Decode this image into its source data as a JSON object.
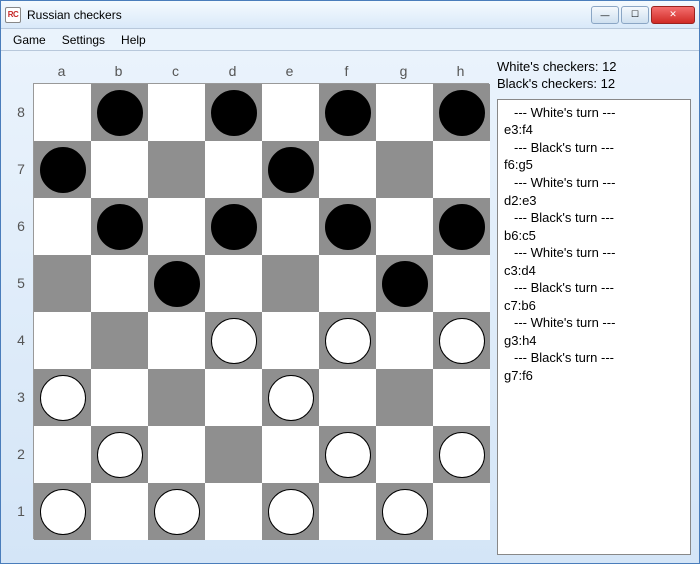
{
  "window": {
    "title": "Russian checkers",
    "icon_text": "RC"
  },
  "menubar": {
    "items": [
      "Game",
      "Settings",
      "Help"
    ]
  },
  "board": {
    "files": [
      "a",
      "b",
      "c",
      "d",
      "e",
      "f",
      "g",
      "h"
    ],
    "ranks": [
      "8",
      "7",
      "6",
      "5",
      "4",
      "3",
      "2",
      "1"
    ],
    "pieces": [
      {
        "file": "b",
        "rank": 8,
        "color": "black"
      },
      {
        "file": "d",
        "rank": 8,
        "color": "black"
      },
      {
        "file": "f",
        "rank": 8,
        "color": "black"
      },
      {
        "file": "h",
        "rank": 8,
        "color": "black"
      },
      {
        "file": "a",
        "rank": 7,
        "color": "black"
      },
      {
        "file": "e",
        "rank": 7,
        "color": "black"
      },
      {
        "file": "b",
        "rank": 6,
        "color": "black"
      },
      {
        "file": "d",
        "rank": 6,
        "color": "black"
      },
      {
        "file": "f",
        "rank": 6,
        "color": "black"
      },
      {
        "file": "h",
        "rank": 6,
        "color": "black"
      },
      {
        "file": "c",
        "rank": 5,
        "color": "black"
      },
      {
        "file": "g",
        "rank": 5,
        "color": "black"
      },
      {
        "file": "d",
        "rank": 4,
        "color": "white"
      },
      {
        "file": "f",
        "rank": 4,
        "color": "white"
      },
      {
        "file": "h",
        "rank": 4,
        "color": "white"
      },
      {
        "file": "a",
        "rank": 3,
        "color": "white"
      },
      {
        "file": "e",
        "rank": 3,
        "color": "white"
      },
      {
        "file": "b",
        "rank": 2,
        "color": "white"
      },
      {
        "file": "f",
        "rank": 2,
        "color": "white"
      },
      {
        "file": "h",
        "rank": 2,
        "color": "white"
      },
      {
        "file": "a",
        "rank": 1,
        "color": "white"
      },
      {
        "file": "c",
        "rank": 1,
        "color": "white"
      },
      {
        "file": "e",
        "rank": 1,
        "color": "white"
      },
      {
        "file": "g",
        "rank": 1,
        "color": "white"
      }
    ]
  },
  "sidebar": {
    "white_label": "White's checkers: 12",
    "black_label": "Black's checkers: 12",
    "log": [
      {
        "type": "turn",
        "text": "--- White's turn ---"
      },
      {
        "type": "move",
        "text": "e3:f4"
      },
      {
        "type": "turn",
        "text": "--- Black's turn ---"
      },
      {
        "type": "move",
        "text": "f6:g5"
      },
      {
        "type": "turn",
        "text": "--- White's turn ---"
      },
      {
        "type": "move",
        "text": "d2:e3"
      },
      {
        "type": "turn",
        "text": "--- Black's turn ---"
      },
      {
        "type": "move",
        "text": "b6:c5"
      },
      {
        "type": "turn",
        "text": "--- White's turn ---"
      },
      {
        "type": "move",
        "text": "c3:d4"
      },
      {
        "type": "turn",
        "text": "--- Black's turn ---"
      },
      {
        "type": "move",
        "text": "c7:b6"
      },
      {
        "type": "turn",
        "text": "--- White's turn ---"
      },
      {
        "type": "move",
        "text": "g3:h4"
      },
      {
        "type": "turn",
        "text": "--- Black's turn ---"
      },
      {
        "type": "move",
        "text": "g7:f6"
      }
    ]
  }
}
